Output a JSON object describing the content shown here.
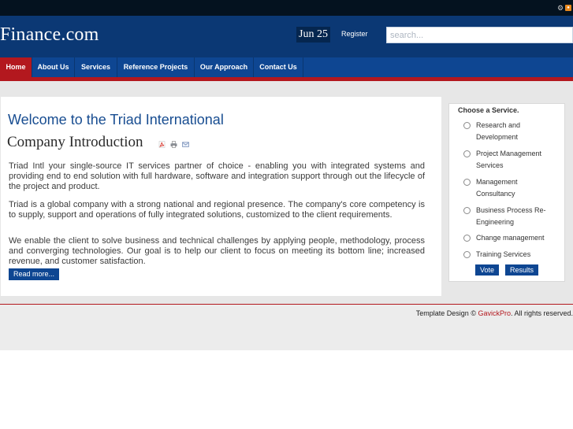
{
  "site": {
    "logo": "Finance.com",
    "date": "Jun 25",
    "register": "Register",
    "search_placeholder": "search..."
  },
  "nav": {
    "items": [
      {
        "label": "Home"
      },
      {
        "label": "About Us"
      },
      {
        "label": "Services"
      },
      {
        "label": "Reference Projects"
      },
      {
        "label": "Our Approach"
      },
      {
        "label": "Contact Us"
      }
    ],
    "active": "Home"
  },
  "article": {
    "welcome": "Welcome to the Triad International",
    "title": "Company Introduction",
    "icons": [
      "pdf-icon",
      "print-icon",
      "email-icon"
    ],
    "paragraphs": [
      "Triad Intl your single-source IT services partner of choice - enabling you with integrated systems and providing end to end solution with full hardware, software and integration support through out the lifecycle of the project and product.",
      "Triad is a global company with a strong national and regional presence. The company's core competency is to supply, support and operations of fully integrated solutions, customized to the client requirements.",
      "We enable the client to solve business and technical challenges by applying people, methodology, process and converging technologies. Our goal is to help our client to focus on meeting its bottom line; increased revenue, and customer satisfaction."
    ],
    "read_more": "Read more..."
  },
  "poll": {
    "title": "Choose a Service.",
    "options": [
      "Research and Development",
      "Project Management Services",
      "Management Consultancy",
      "Business Process Re-Engineering",
      "Change management",
      "Training Services"
    ],
    "vote": "Vote",
    "results": "Results"
  },
  "footer": {
    "prefix": "Template Design © ",
    "link": "GavickPro",
    "suffix": ". All rights reserved."
  },
  "colors": {
    "header_bg": "#0b3874",
    "nav_bg": "#0e4692",
    "accent_red": "#b3181e",
    "title_blue": "#184d91"
  }
}
